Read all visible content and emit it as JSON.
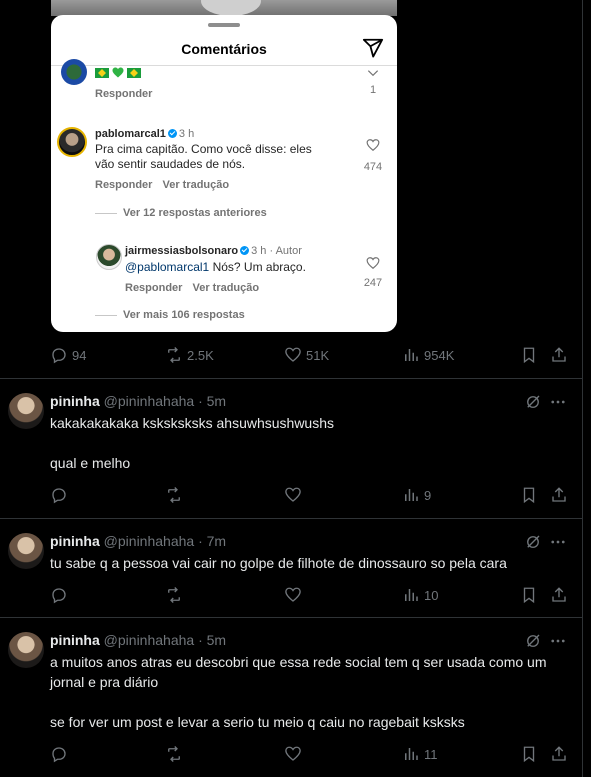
{
  "instagram_embed": {
    "title": "Comentários",
    "top_comment": {
      "emojis": [
        "brazil-flag",
        "green-heart",
        "brazil-flag"
      ],
      "reply_label": "Responder",
      "likes": "1"
    },
    "main_comment": {
      "user": "pablomarcal1",
      "time": "3 h",
      "text_line1": "Pra cima capitão. Como você disse: eles",
      "text_line2": "vão sentir saudades de nós.",
      "reply_label": "Responder",
      "translate_label": "Ver tradução",
      "likes": "474"
    },
    "view_previous": "Ver 12 respostas anteriores",
    "reply": {
      "user": "jairmessiasbolsonaro",
      "time": "3 h",
      "author_tag": "Autor",
      "mention": "@pablomarcal1",
      "text": " Nós? Um abraço.",
      "reply_label": "Responder",
      "translate_label": "Ver tradução",
      "likes": "247"
    },
    "view_more": "Ver mais 106 respostas"
  },
  "main_actions": {
    "replies": "94",
    "reposts": "2.5K",
    "likes": "51K",
    "views": "954K"
  },
  "tweets": [
    {
      "name": "pininha",
      "handle": "@pininhahaha",
      "time": "5m",
      "lines": [
        "kakakakakaka ksksksksks ahsuwhsushwushs",
        "qual e melho"
      ],
      "views": "9"
    },
    {
      "name": "pininha",
      "handle": "@pininhahaha",
      "time": "7m",
      "lines": [
        "tu sabe q a pessoa vai cair no golpe de filhote de dinossauro so pela cara"
      ],
      "views": "10"
    },
    {
      "name": "pininha",
      "handle": "@pininhahaha",
      "time": "5m",
      "lines": [
        "a muitos anos atras eu descobri que essa rede social tem q ser usada como um jornal e pra diário",
        "se for ver um post e levar a serio tu meio q caiu no ragebait ksksks"
      ],
      "views": "11"
    }
  ],
  "colors": {
    "background": "#000000",
    "text": "#e7e9ea",
    "muted": "#71767b",
    "border": "#2f3336",
    "ig_blue": "#0095f6"
  }
}
